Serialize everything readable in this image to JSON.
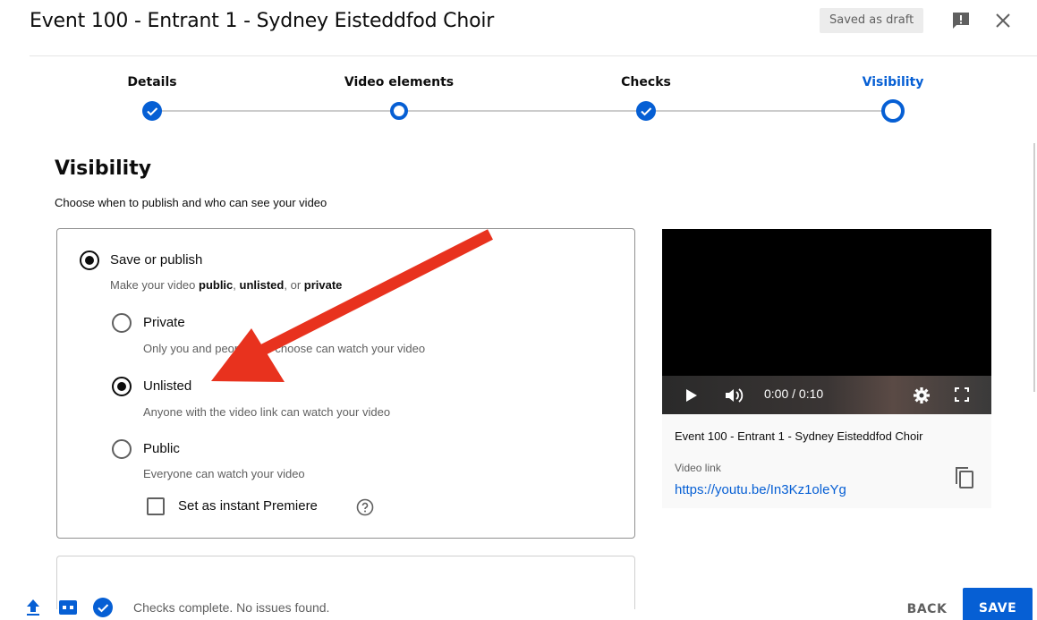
{
  "header": {
    "title": "Event 100 - Entrant 1 - Sydney Eisteddfod Choir",
    "draft_status": "Saved as draft",
    "feedback_icon": "feedback-icon",
    "close_icon": "close-icon"
  },
  "stepper": {
    "steps": [
      {
        "label": "Details",
        "state": "done"
      },
      {
        "label": "Video elements",
        "state": "visited"
      },
      {
        "label": "Checks",
        "state": "done"
      },
      {
        "label": "Visibility",
        "state": "active"
      }
    ],
    "accent": "#065fd4"
  },
  "visibility": {
    "heading": "Visibility",
    "subheading": "Choose when to publish and who can see your video",
    "save_or_publish": {
      "label": "Save or publish",
      "desc_prefix": "Make your video ",
      "desc_public": "public",
      "desc_sep1": ", ",
      "desc_unlisted": "unlisted",
      "desc_sep2": ", or ",
      "desc_private": "private",
      "selected": true
    },
    "options": [
      {
        "label": "Private",
        "desc": "Only you and people you choose can watch your video",
        "selected": false
      },
      {
        "label": "Unlisted",
        "desc": "Anyone with the video link can watch your video",
        "selected": true
      },
      {
        "label": "Public",
        "desc": "Everyone can watch your video",
        "selected": false
      }
    ],
    "premiere": {
      "label": "Set as instant Premiere",
      "checked": false,
      "help_icon": "help-icon"
    }
  },
  "preview": {
    "time": "0:00 / 0:10",
    "video_title": "Event 100 - Entrant 1 - Sydney Eisteddfod Choir",
    "link_label": "Video link",
    "link_value": "https://youtu.be/In3Kz1oleYg",
    "copy_icon": "copy-icon"
  },
  "annotation": {
    "type": "arrow",
    "color": "#e8321e"
  },
  "footer": {
    "status": "Checks complete. No issues found.",
    "back_label": "BACK",
    "save_label": "SAVE",
    "icons": [
      "upload-icon",
      "hd-icon",
      "check-circle-icon"
    ]
  }
}
